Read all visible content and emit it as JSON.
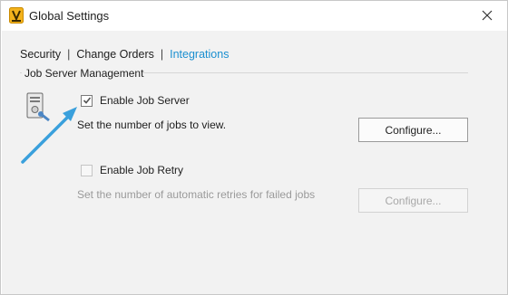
{
  "window": {
    "title": "Global Settings",
    "app_icon": "vault-app-icon",
    "close_icon": "close-icon"
  },
  "tabs": [
    {
      "label": "Security",
      "active": false
    },
    {
      "label": "Change Orders",
      "active": false
    },
    {
      "label": "Integrations",
      "active": true
    }
  ],
  "tab_separator": "|",
  "group": {
    "label": "Job Server Management"
  },
  "job_server": {
    "icon": "job-server-icon",
    "checkbox_label": "Enable Job Server",
    "checked": true,
    "description": "Set the number of jobs to view.",
    "button_label": "Configure..."
  },
  "job_retry": {
    "checkbox_label": "Enable Job Retry",
    "checked": false,
    "description": "Set the number of automatic retries for failed jobs",
    "button_label": "Configure...",
    "button_enabled": false
  },
  "colors": {
    "accent": "#1a8fd0",
    "annotation_arrow": "#3aa0dc",
    "content_bg": "#f2f2f2"
  }
}
